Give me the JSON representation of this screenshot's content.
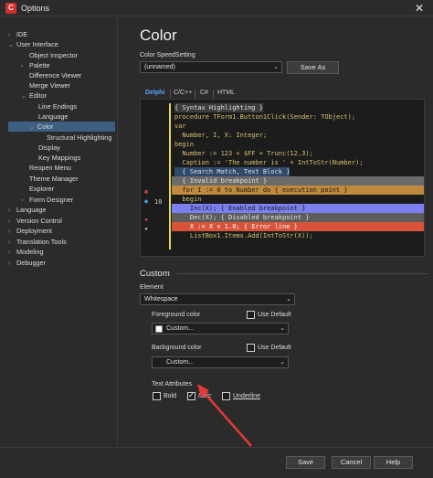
{
  "window": {
    "title": "Options",
    "close_glyph": "✕",
    "app_icon_glyph": "C"
  },
  "tree": {
    "items": [
      {
        "label": "IDE",
        "arrow": "›"
      },
      {
        "label": "User Interface",
        "arrow": "⌄"
      },
      {
        "label": "Object Inspector",
        "arrow": ""
      },
      {
        "label": "Palette",
        "arrow": "›"
      },
      {
        "label": "Difference Viewer",
        "arrow": ""
      },
      {
        "label": "Merge Viewer",
        "arrow": ""
      },
      {
        "label": "Editor",
        "arrow": "⌄"
      },
      {
        "label": "Line Endings",
        "arrow": ""
      },
      {
        "label": "Language",
        "arrow": ""
      },
      {
        "label": "Color",
        "arrow": "⌄"
      },
      {
        "label": "Structural Highlighting",
        "arrow": ""
      },
      {
        "label": "Display",
        "arrow": ""
      },
      {
        "label": "Key Mappings",
        "arrow": ""
      },
      {
        "label": "Reopen Menu",
        "arrow": ""
      },
      {
        "label": "Theme Manager",
        "arrow": ""
      },
      {
        "label": "Explorer",
        "arrow": ""
      },
      {
        "label": "Form Designer",
        "arrow": "›"
      },
      {
        "label": "Language",
        "arrow": "›"
      },
      {
        "label": "Version Control",
        "arrow": "›"
      },
      {
        "label": "Deployment",
        "arrow": "›"
      },
      {
        "label": "Translation Tools",
        "arrow": "›"
      },
      {
        "label": "Modeling",
        "arrow": "›"
      },
      {
        "label": "Debugger",
        "arrow": "›"
      }
    ]
  },
  "page": {
    "title": "Color",
    "speedsetting_label": "Color SpeedSetting",
    "speedsetting_value": "(unnamed)",
    "save_as_label": "Save As",
    "tabs": [
      "Delphi",
      "C/C++",
      "C#",
      "HTML"
    ],
    "editor_line_number": "10",
    "code_lines": [
      "{ Syntax Highlighting }",
      "procedure TForm1.Button1Click(Sender: TObject);",
      "var",
      "  Number, I, X: Integer;",
      "begin",
      "  Number := 123 + $FF + Trunc(12.3);",
      "  Caption := 'The number is ' + IntToStr(Number);",
      "  { Search Match, Text Block }",
      "  { Invalid breakpoint }",
      "  for I := 0 to Number do { execution point }",
      "  begin",
      "    Inc(X); { Enabled breakpoint }",
      "    Dec(X); { Disabled breakpoint }",
      "    X := X + 1.0; { Error line }",
      "    ListBox1.Items.Add(IntToStr(X));"
    ],
    "custom_section_title": "Custom",
    "element_label": "Element",
    "element_value": "Whitespace",
    "foreground_label": "Foreground color",
    "foreground_value": "Custom...",
    "background_label": "Background color",
    "background_value": "Custom...",
    "use_default_label": "Use Default",
    "text_attributes_label": "Text Attributes",
    "bold_label": "Bold",
    "italic_label": "Italic",
    "underline_label": "Underline",
    "italic_checked": true,
    "bold_checked": false,
    "underline_checked": false
  },
  "footer": {
    "save_label": "Save",
    "cancel_label": "Cancel",
    "help_label": "Help"
  },
  "colors": {
    "accent": "#5aa0ff",
    "selection": "#3e5f82",
    "invalid_bp": "#6b6b6b",
    "exec_point": "#c08a3c",
    "enabled_bp": "#7b7ff0",
    "disabled_bp": "#5d5d5d",
    "error_line": "#d9533a",
    "annotation_arrow": "#e53935"
  },
  "icons": {
    "breakpoint_invalid": "✖",
    "execution_point": "◆",
    "breakpoint_enabled": "●",
    "breakpoint_disabled": "●",
    "dropdown_caret": "⌄"
  }
}
